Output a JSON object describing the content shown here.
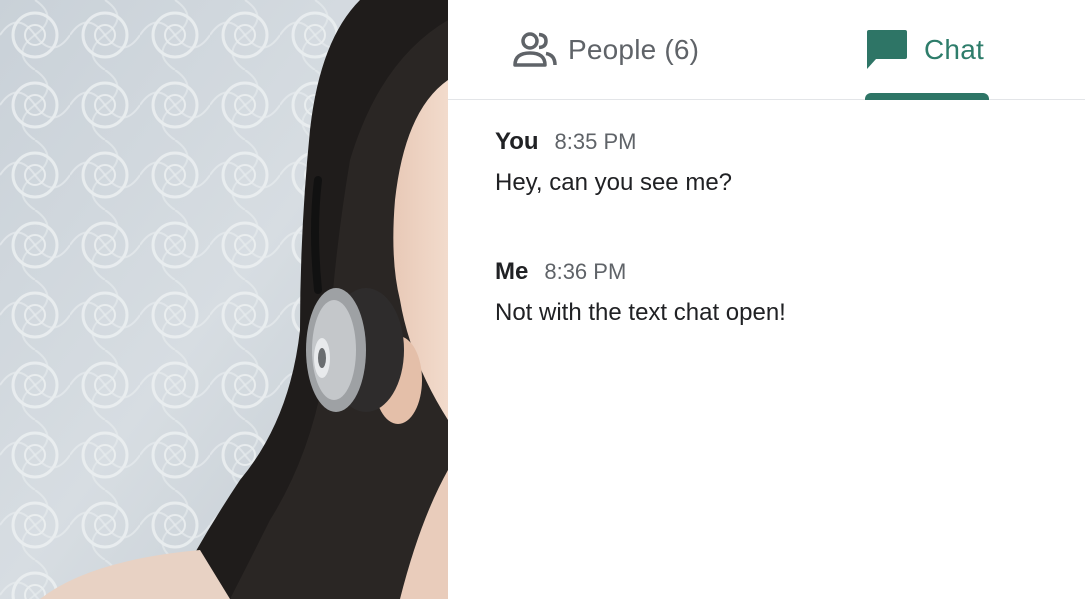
{
  "tabs": {
    "people": {
      "label": "People (6)",
      "icon": "people-icon"
    },
    "chat": {
      "label": "Chat",
      "icon": "chat-icon",
      "active": true
    }
  },
  "messages": [
    {
      "sender": "You",
      "time": "8:35 PM",
      "text": "Hey, can you see me?"
    },
    {
      "sender": "Me",
      "time": "8:36 PM",
      "text": "Not with the text chat open!"
    }
  ],
  "colors": {
    "accent": "#2e7566",
    "tab_inactive": "#5f6368",
    "text": "#202124",
    "muted": "#5f6368",
    "divider": "#e3e5e8"
  }
}
